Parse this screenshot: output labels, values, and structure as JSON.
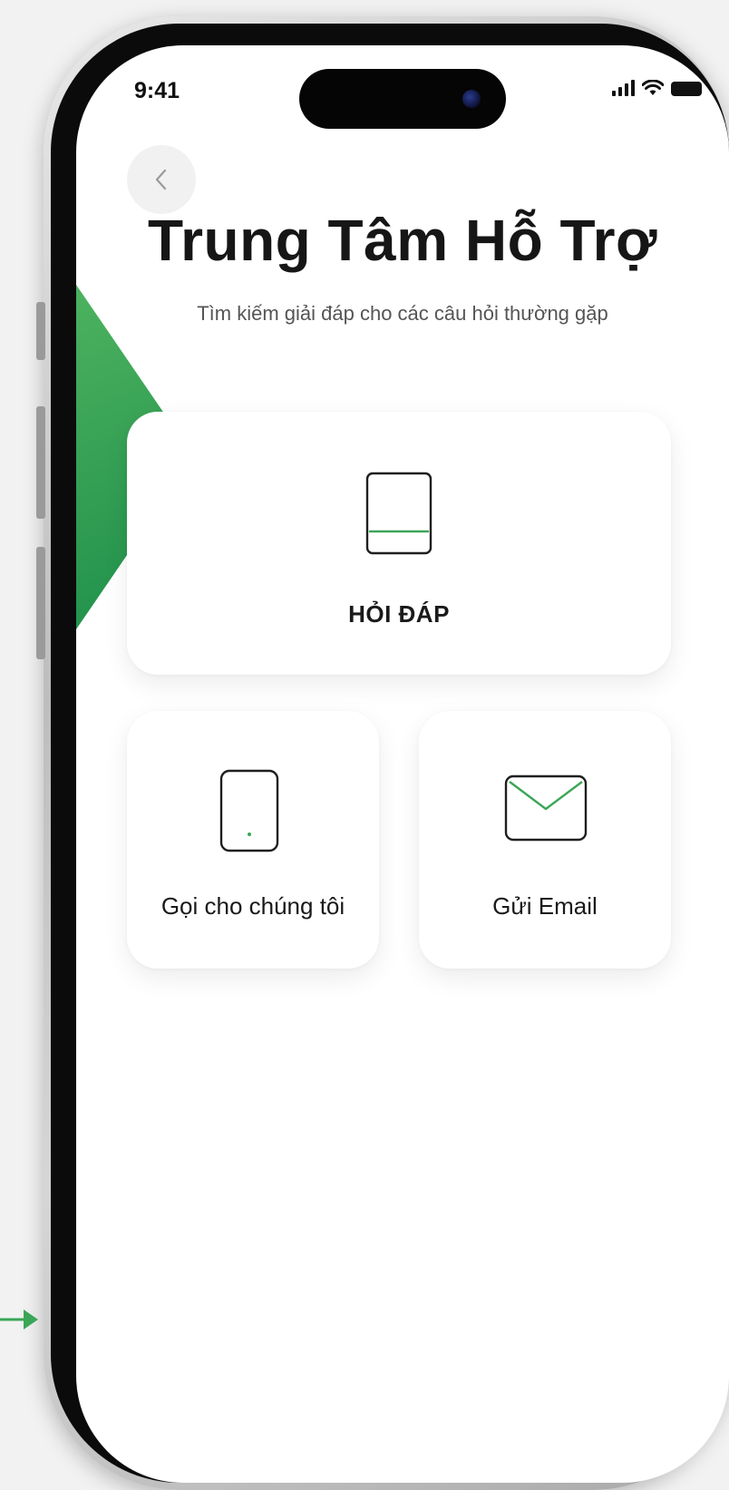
{
  "status_bar": {
    "time": "9:41"
  },
  "header": {
    "title": "Trung Tâm Hỗ Trợ",
    "subtitle": "Tìm kiếm giải đáp cho các câu hỏi thường gặp"
  },
  "cards": {
    "faq": {
      "label": "HỎI ĐÁP",
      "icon": "book-icon"
    },
    "call": {
      "label": "Gọi cho chúng tôi",
      "icon": "phone-icon"
    },
    "email": {
      "label": "Gửi Email",
      "icon": "mail-icon"
    }
  },
  "colors": {
    "accent": "#3aa657",
    "card_background": "#ffffff",
    "title_text": "#161616"
  }
}
